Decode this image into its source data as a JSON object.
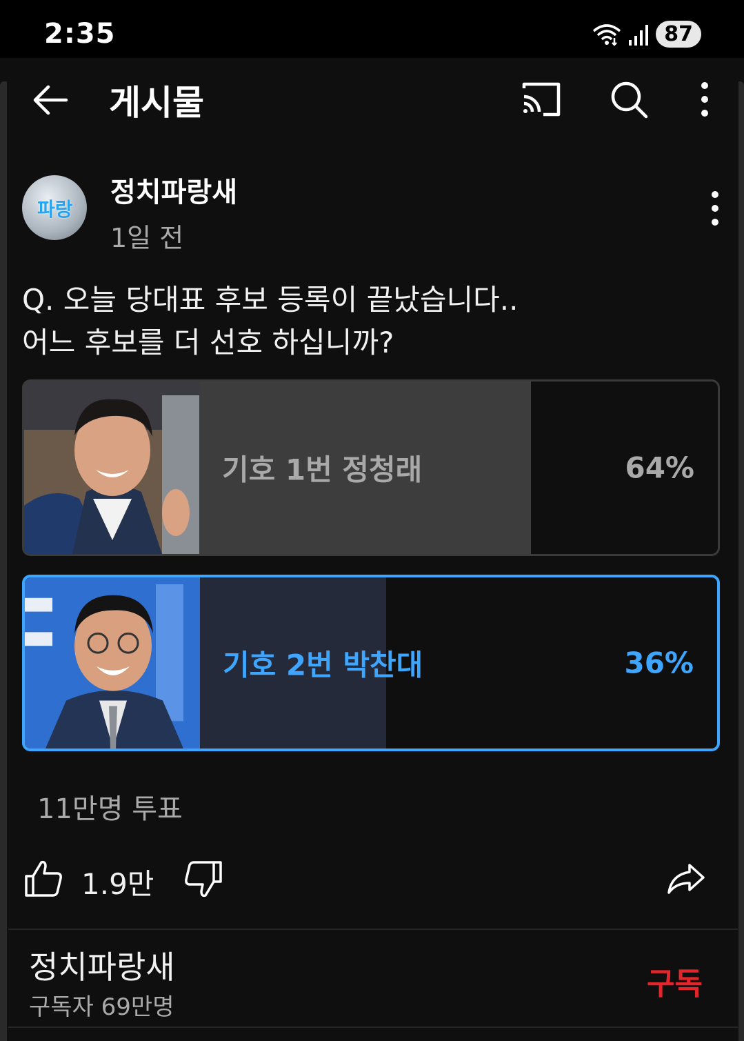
{
  "status_bar": {
    "time": "2:35",
    "battery": "87"
  },
  "header": {
    "title": "게시물",
    "icons": [
      "back-arrow-icon",
      "cast-icon",
      "search-icon",
      "more-vert-icon"
    ]
  },
  "post": {
    "channel_name": "정치파랑새",
    "avatar_text": "파랑",
    "time_ago": "1일 전",
    "question": "Q. 오늘 당대표 후보 등록이 끝났습니다..\n어느 후보를 더 선호 하십니까?",
    "poll": {
      "options": [
        {
          "label": "기호 1번 정청래",
          "percent_text": "64%",
          "percent": 64,
          "selected": false
        },
        {
          "label": "기호 2번 박찬대",
          "percent_text": "36%",
          "percent": 36,
          "selected": true
        }
      ],
      "vote_count": "11만명 투표"
    },
    "actions": {
      "like_count": "1.9만",
      "icons": [
        "thumb-up-icon",
        "thumb-down-icon",
        "share-icon"
      ]
    }
  },
  "subscription": {
    "channel_name": "정치파랑새",
    "subscriber_count": "구독자 69만명",
    "subscribe_label": "구독"
  },
  "colors": {
    "accent": "#3ea6ff",
    "subscribe": "#e2262b",
    "background": "#0f0f0f"
  }
}
